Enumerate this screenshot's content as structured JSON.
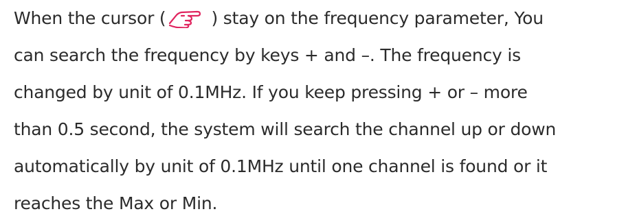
{
  "document": {
    "line1_pre": "When the cursor (",
    "line1_post": ") stay on the frequency parameter, You",
    "line2": "can search the frequency by keys + and –. The frequency is",
    "line3": "changed by unit of 0.1MHz. If you keep pressing + or – more",
    "line4": "than 0.5 second, the system will search the channel up or down",
    "line5": "automatically by unit of 0.1MHz until one channel is found or it",
    "line6": "reaches the Max or Min.",
    "cursor_icon": "pointing-hand-icon",
    "text_color": "#2b2b2b",
    "icon_color": "#e0245e"
  }
}
